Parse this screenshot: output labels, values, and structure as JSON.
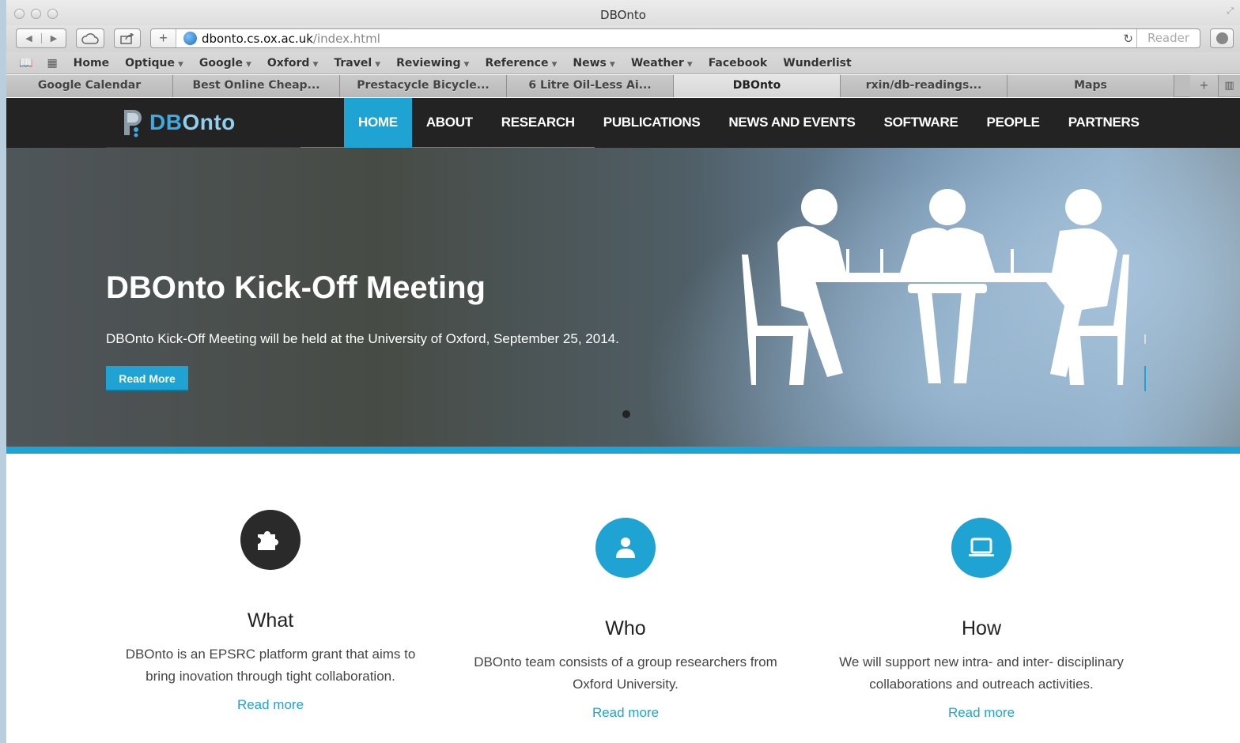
{
  "window": {
    "title": "DBOnto"
  },
  "toolbar": {
    "url_host": "dbonto.cs.ox.ac.uk",
    "url_path": "/index.html",
    "reader_label": "Reader"
  },
  "bookmarks": [
    {
      "label": "Home",
      "menu": false
    },
    {
      "label": "Optique",
      "menu": true
    },
    {
      "label": "Google",
      "menu": true
    },
    {
      "label": "Oxford",
      "menu": true
    },
    {
      "label": "Travel",
      "menu": true
    },
    {
      "label": "Reviewing",
      "menu": true
    },
    {
      "label": "Reference",
      "menu": true
    },
    {
      "label": "News",
      "menu": true
    },
    {
      "label": "Weather",
      "menu": true
    },
    {
      "label": "Facebook",
      "menu": false
    },
    {
      "label": "Wunderlist",
      "menu": false
    }
  ],
  "tabs": [
    {
      "label": "Google Calendar",
      "active": false
    },
    {
      "label": "Best Online Cheap...",
      "active": false
    },
    {
      "label": "Prestacycle Bicycle...",
      "active": false
    },
    {
      "label": "6 Litre Oil-Less Ai...",
      "active": false
    },
    {
      "label": "DBOnto",
      "active": true
    },
    {
      "label": "rxin/db-readings...",
      "active": false
    },
    {
      "label": "Maps",
      "active": false
    }
  ],
  "site": {
    "logo_text_a": "DB",
    "logo_text_b": "Onto",
    "menu": [
      {
        "label": "HOME",
        "active": true
      },
      {
        "label": "ABOUT",
        "active": false
      },
      {
        "label": "RESEARCH",
        "active": false
      },
      {
        "label": "PUBLICATIONS",
        "active": false
      },
      {
        "label": "NEWS AND EVENTS",
        "active": false
      },
      {
        "label": "SOFTWARE",
        "active": false
      },
      {
        "label": "PEOPLE",
        "active": false
      },
      {
        "label": "PARTNERS",
        "active": false
      }
    ]
  },
  "hero": {
    "title": "DBOnto Kick-Off Meeting",
    "text": "DBOnto Kick-Off Meeting will be held at the University of Oxford, September 25, 2014.",
    "button": "Read More"
  },
  "features": [
    {
      "icon": "puzzle-icon",
      "color": "#2a2a2a",
      "title": "What",
      "text": "DBOnto is an EPSRC platform grant that aims to bring inovation through tight collaboration.",
      "link": "Read more"
    },
    {
      "icon": "user-icon",
      "color": "#1ea3d2",
      "title": "Who",
      "text": "DBOnto team consists of a group researchers from Oxford University.",
      "link": "Read more"
    },
    {
      "icon": "laptop-icon",
      "color": "#1ea3d2",
      "title": "How",
      "text": "We will support new intra- and inter- disciplinary collaborations and outreach activities.",
      "link": "Read more"
    }
  ],
  "colors": {
    "accent": "#1ea3d2",
    "nav_bg": "#232323"
  }
}
